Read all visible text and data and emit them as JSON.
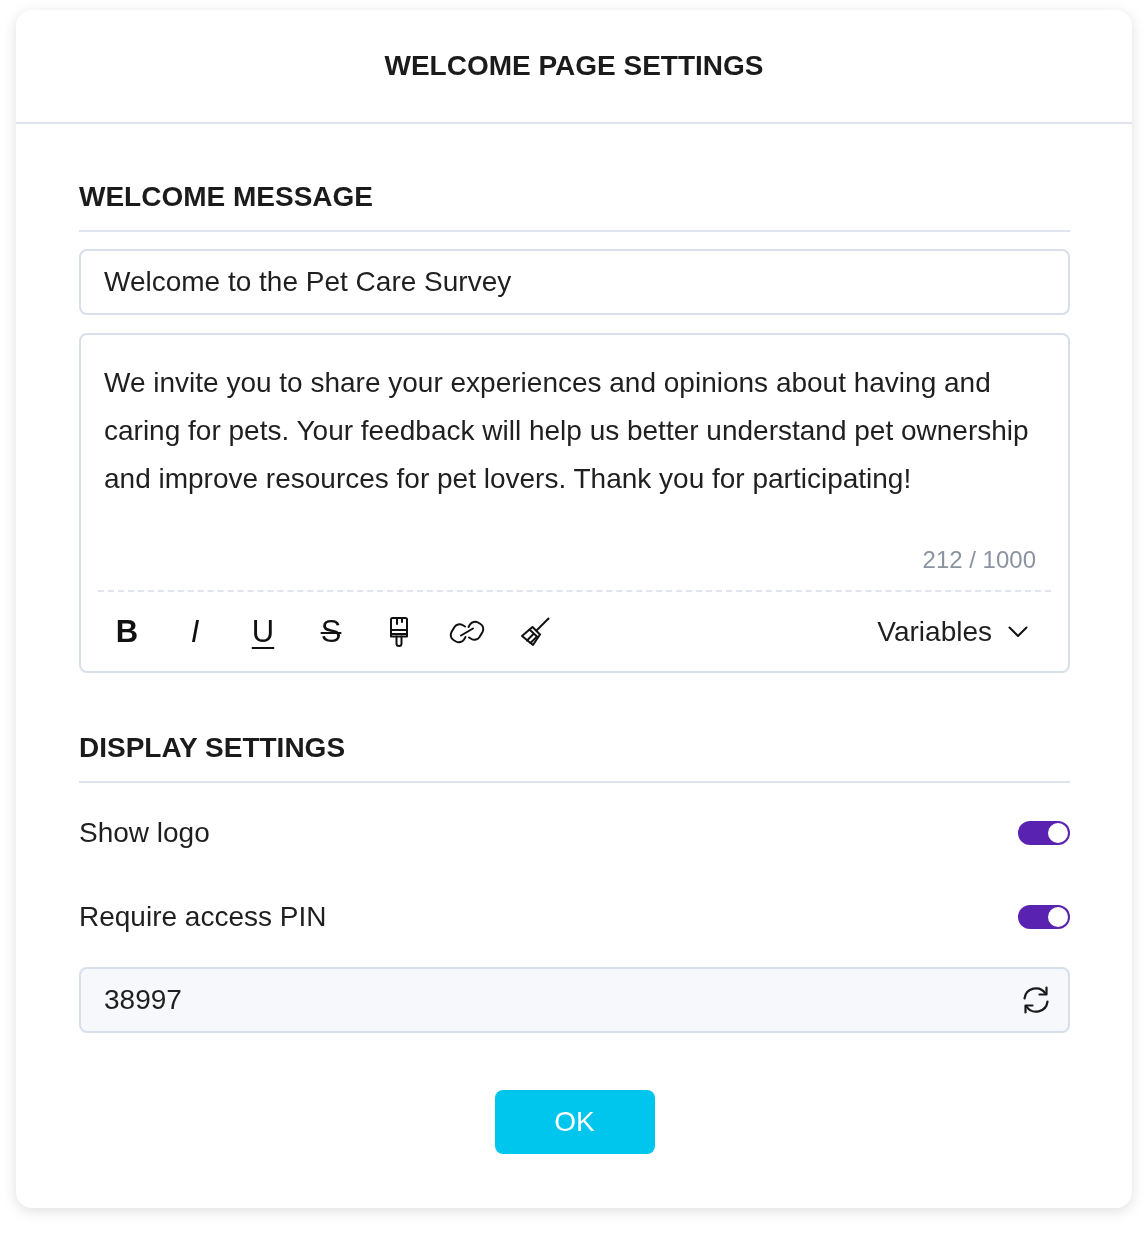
{
  "dialog": {
    "title": "WELCOME PAGE SETTINGS"
  },
  "welcome_message": {
    "heading": "WELCOME MESSAGE",
    "title_field": {
      "value": "Welcome to the Pet Care Survey"
    },
    "body_field": {
      "value": "We invite you to share your experiences and opinions about having and caring for pets. Your feedback will help us better understand pet ownership and improve resources for pet lovers. Thank you for participating!",
      "counter": "212 / 1000"
    },
    "toolbar": {
      "buttons": [
        {
          "kind": "bold",
          "label": "B"
        },
        {
          "kind": "italic",
          "label": "I"
        },
        {
          "kind": "underline",
          "label": "U"
        },
        {
          "kind": "strikethrough",
          "label": "S"
        },
        {
          "kind": "brush"
        },
        {
          "kind": "link"
        },
        {
          "kind": "broom"
        }
      ],
      "variables_dropdown": {
        "label": "Variables"
      }
    }
  },
  "display_settings": {
    "heading": "DISPLAY SETTINGS",
    "toggles": [
      {
        "label": "Show logo",
        "on": true
      },
      {
        "label": "Require access PIN",
        "on": true
      }
    ],
    "pin_field": {
      "value": "38997"
    }
  },
  "buttons": [
    {
      "label": "OK"
    }
  ]
}
